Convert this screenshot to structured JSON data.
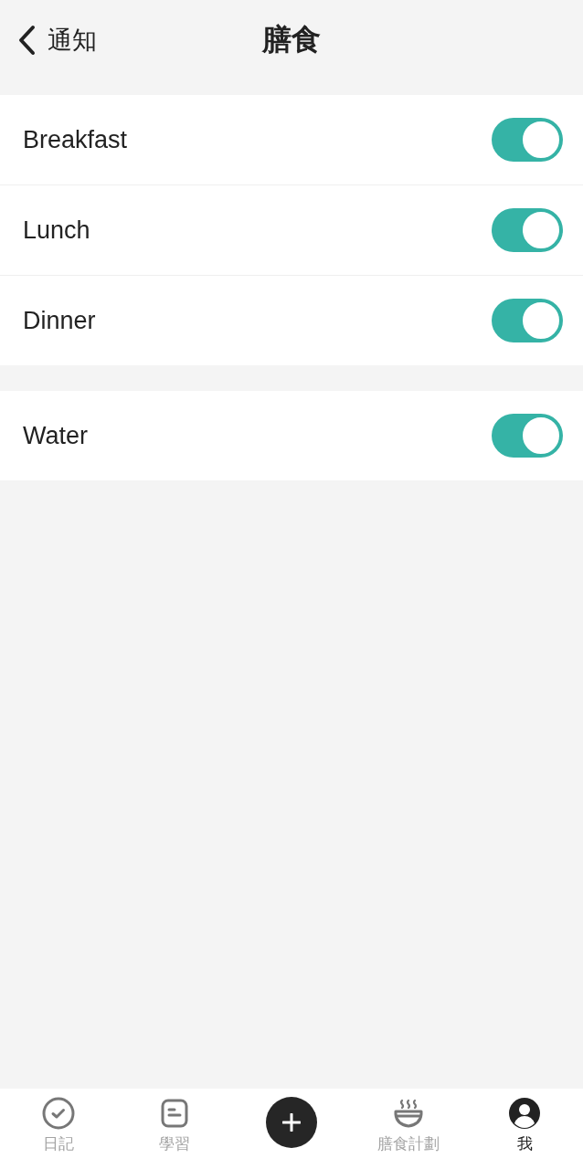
{
  "header": {
    "back_label": "通知",
    "title": "膳食"
  },
  "sections": [
    {
      "items": [
        {
          "label": "Breakfast",
          "on": true
        },
        {
          "label": "Lunch",
          "on": true
        },
        {
          "label": "Dinner",
          "on": true
        }
      ]
    },
    {
      "items": [
        {
          "label": "Water",
          "on": true
        }
      ]
    }
  ],
  "tab_bar": {
    "items": [
      {
        "kind": "tab",
        "label": "日記",
        "selected": false
      },
      {
        "kind": "tab",
        "label": "學習",
        "selected": false
      },
      {
        "kind": "add"
      },
      {
        "kind": "tab",
        "label": "膳食計劃",
        "selected": false
      },
      {
        "kind": "tab",
        "label": "我",
        "selected": true
      }
    ]
  }
}
